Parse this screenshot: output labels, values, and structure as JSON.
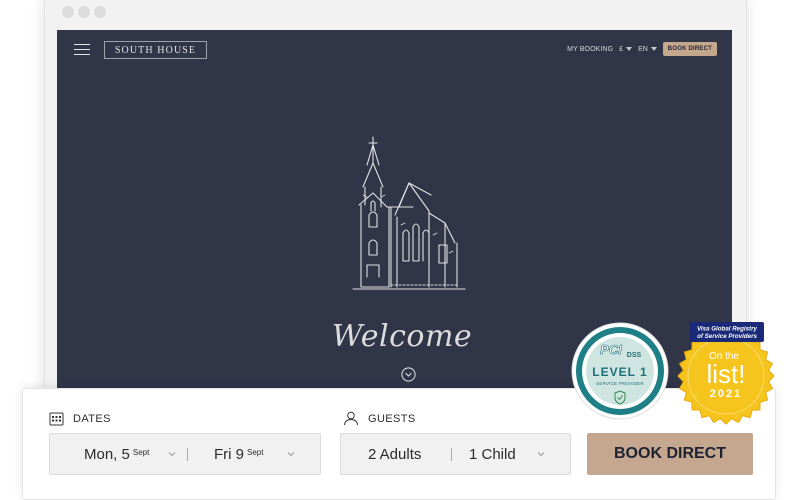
{
  "colors": {
    "hero_bg": "#313548",
    "accent": "#c5a78f",
    "badge_teal": "#1f7f87",
    "badge_gold": "#f6c51d",
    "visa_blue": "#1a2a78"
  },
  "header": {
    "logo": "SOUTH HOUSE",
    "my_booking": "MY BOOKING",
    "currency": "£",
    "language": "EN",
    "book_direct": "BOOK DIRECT"
  },
  "hero": {
    "welcome": "Welcome"
  },
  "booking": {
    "dates_label": "DATES",
    "checkin_day": "Mon, 5",
    "checkin_month": "Sept",
    "checkout_day": "Fri 9",
    "checkout_month": "Sept",
    "guests_label": "GUESTS",
    "adults": "2 Adults",
    "children": "1 Child",
    "book_button": "BOOK DIRECT"
  },
  "badges": {
    "pci_logo": "PCI",
    "pci_dss": "DSS",
    "pci_level": "LEVEL 1",
    "pci_sub": "SERVICE PROVIDER",
    "visa_banner_1": "Visa Global Registry",
    "visa_banner_2": "of Service Providers",
    "visa_on_the": "On the",
    "visa_list": "list!",
    "visa_year": "2021"
  }
}
